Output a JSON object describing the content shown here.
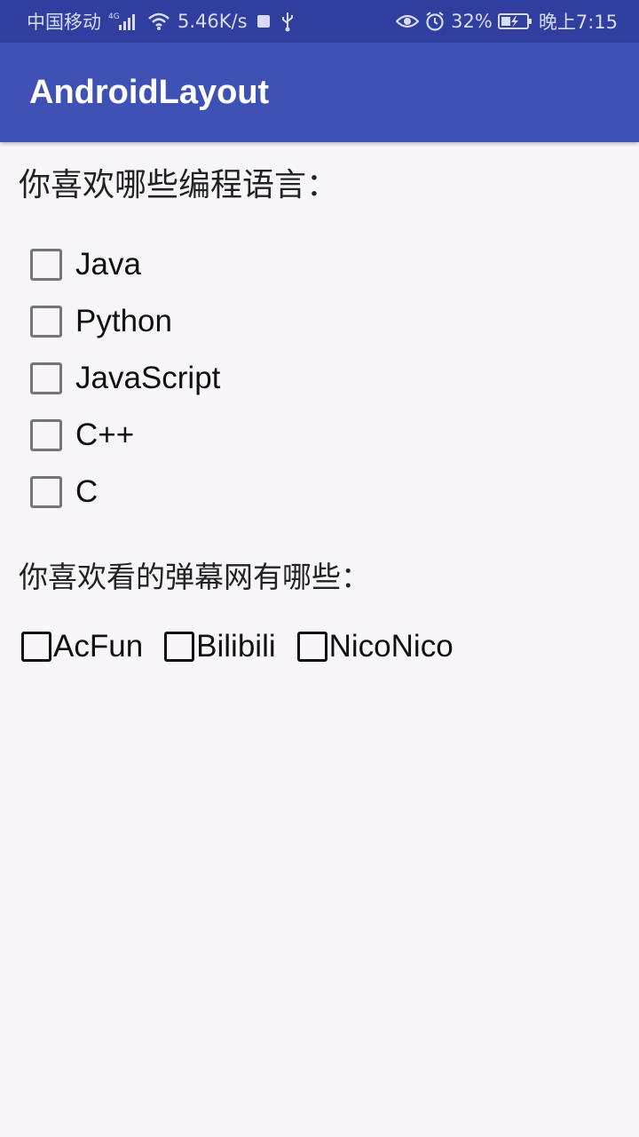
{
  "status_bar": {
    "carrier": "中国移动",
    "network_badge": "4G",
    "speed": "5.46K/s",
    "battery_percent": "32%",
    "time": "晚上7:15",
    "icons": [
      "signal-icon",
      "wifi-icon",
      "notification-square-icon",
      "usb-icon",
      "eye-icon",
      "alarm-icon",
      "battery-icon"
    ]
  },
  "app_bar": {
    "title": "AndroidLayout",
    "color": "#3f51b5"
  },
  "languages": {
    "question": "你喜欢哪些编程语言：",
    "options": [
      {
        "label": "Java",
        "checked": false
      },
      {
        "label": "Python",
        "checked": false
      },
      {
        "label": "JavaScript",
        "checked": false
      },
      {
        "label": "C++",
        "checked": false
      },
      {
        "label": "C",
        "checked": false
      }
    ]
  },
  "sites": {
    "question": "你喜欢看的弹幕网有哪些：",
    "options": [
      {
        "label": "AcFun",
        "checked": false
      },
      {
        "label": "Bilibili",
        "checked": false
      },
      {
        "label": "NicoNico",
        "checked": false
      }
    ]
  }
}
